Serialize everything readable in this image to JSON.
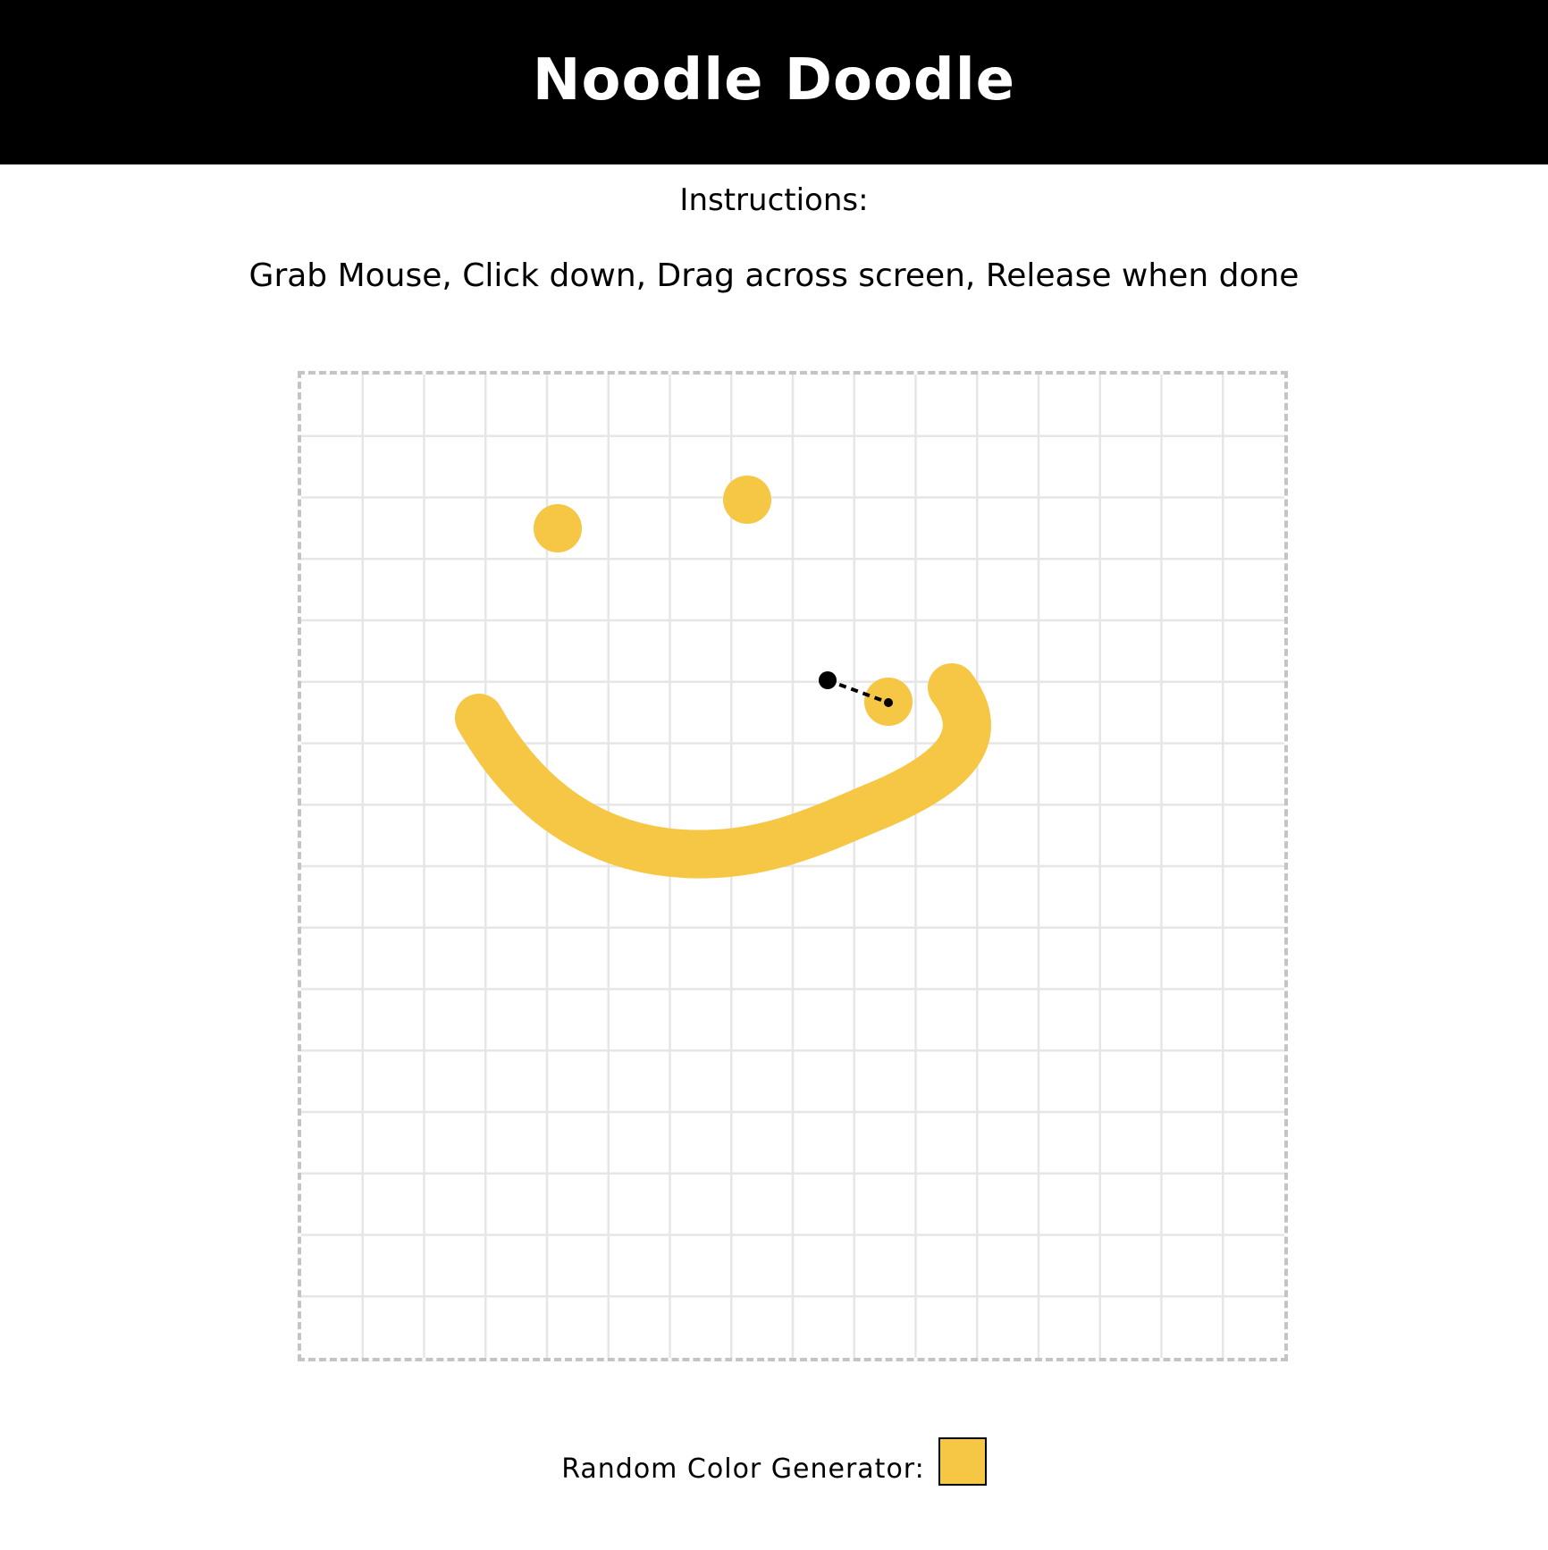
{
  "header": {
    "title": "Noodle Doodle"
  },
  "instructions": {
    "heading": "Instructions:",
    "text": "Grab Mouse, Click down, Drag across screen, Release when done"
  },
  "canvas": {
    "stroke_color": "#f6c744",
    "grid_color": "#e6e6e6",
    "border_color": "#c4c4c4",
    "pointer_color": "#000000"
  },
  "color_generator": {
    "label": "Random Color Generator:",
    "current_color": "#f6c744"
  }
}
